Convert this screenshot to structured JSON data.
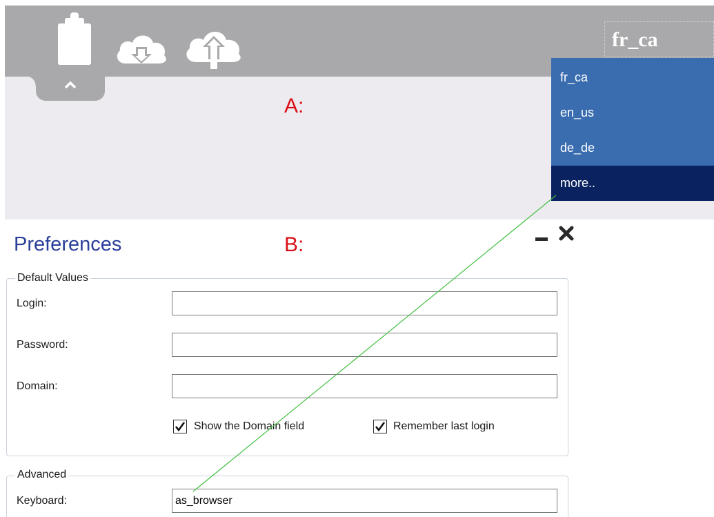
{
  "toolbar": {
    "icons": [
      "clipboard-icon",
      "cloud-download-icon",
      "cloud-upload-icon",
      "chevron-up-icon"
    ],
    "language_selected": "fr_ca"
  },
  "language_dropdown": {
    "options": [
      "fr_ca",
      "en_us",
      "de_de"
    ],
    "more_label": "more.."
  },
  "annotations": {
    "a": "A:",
    "b": "B:"
  },
  "preferences": {
    "title": "Preferences",
    "default_values": {
      "legend": "Default Values",
      "login_label": "Login:",
      "login_value": "",
      "password_label": "Password:",
      "password_value": "",
      "domain_label": "Domain:",
      "domain_value": "",
      "show_domain_label": "Show the Domain field",
      "show_domain_checked": true,
      "remember_login_label": "Remember last login",
      "remember_login_checked": true
    },
    "advanced": {
      "legend": "Advanced",
      "keyboard_label": "Keyboard:",
      "keyboard_value": "as_browser"
    }
  },
  "colors": {
    "toolbar_gray": "#a9a8aa",
    "dropdown_blue": "#3a6db0",
    "dropdown_more": "#0b2260",
    "annotation_red": "#d90f18",
    "title_blue": "#2a3f9a",
    "connector_green": "#3fbf3f"
  }
}
